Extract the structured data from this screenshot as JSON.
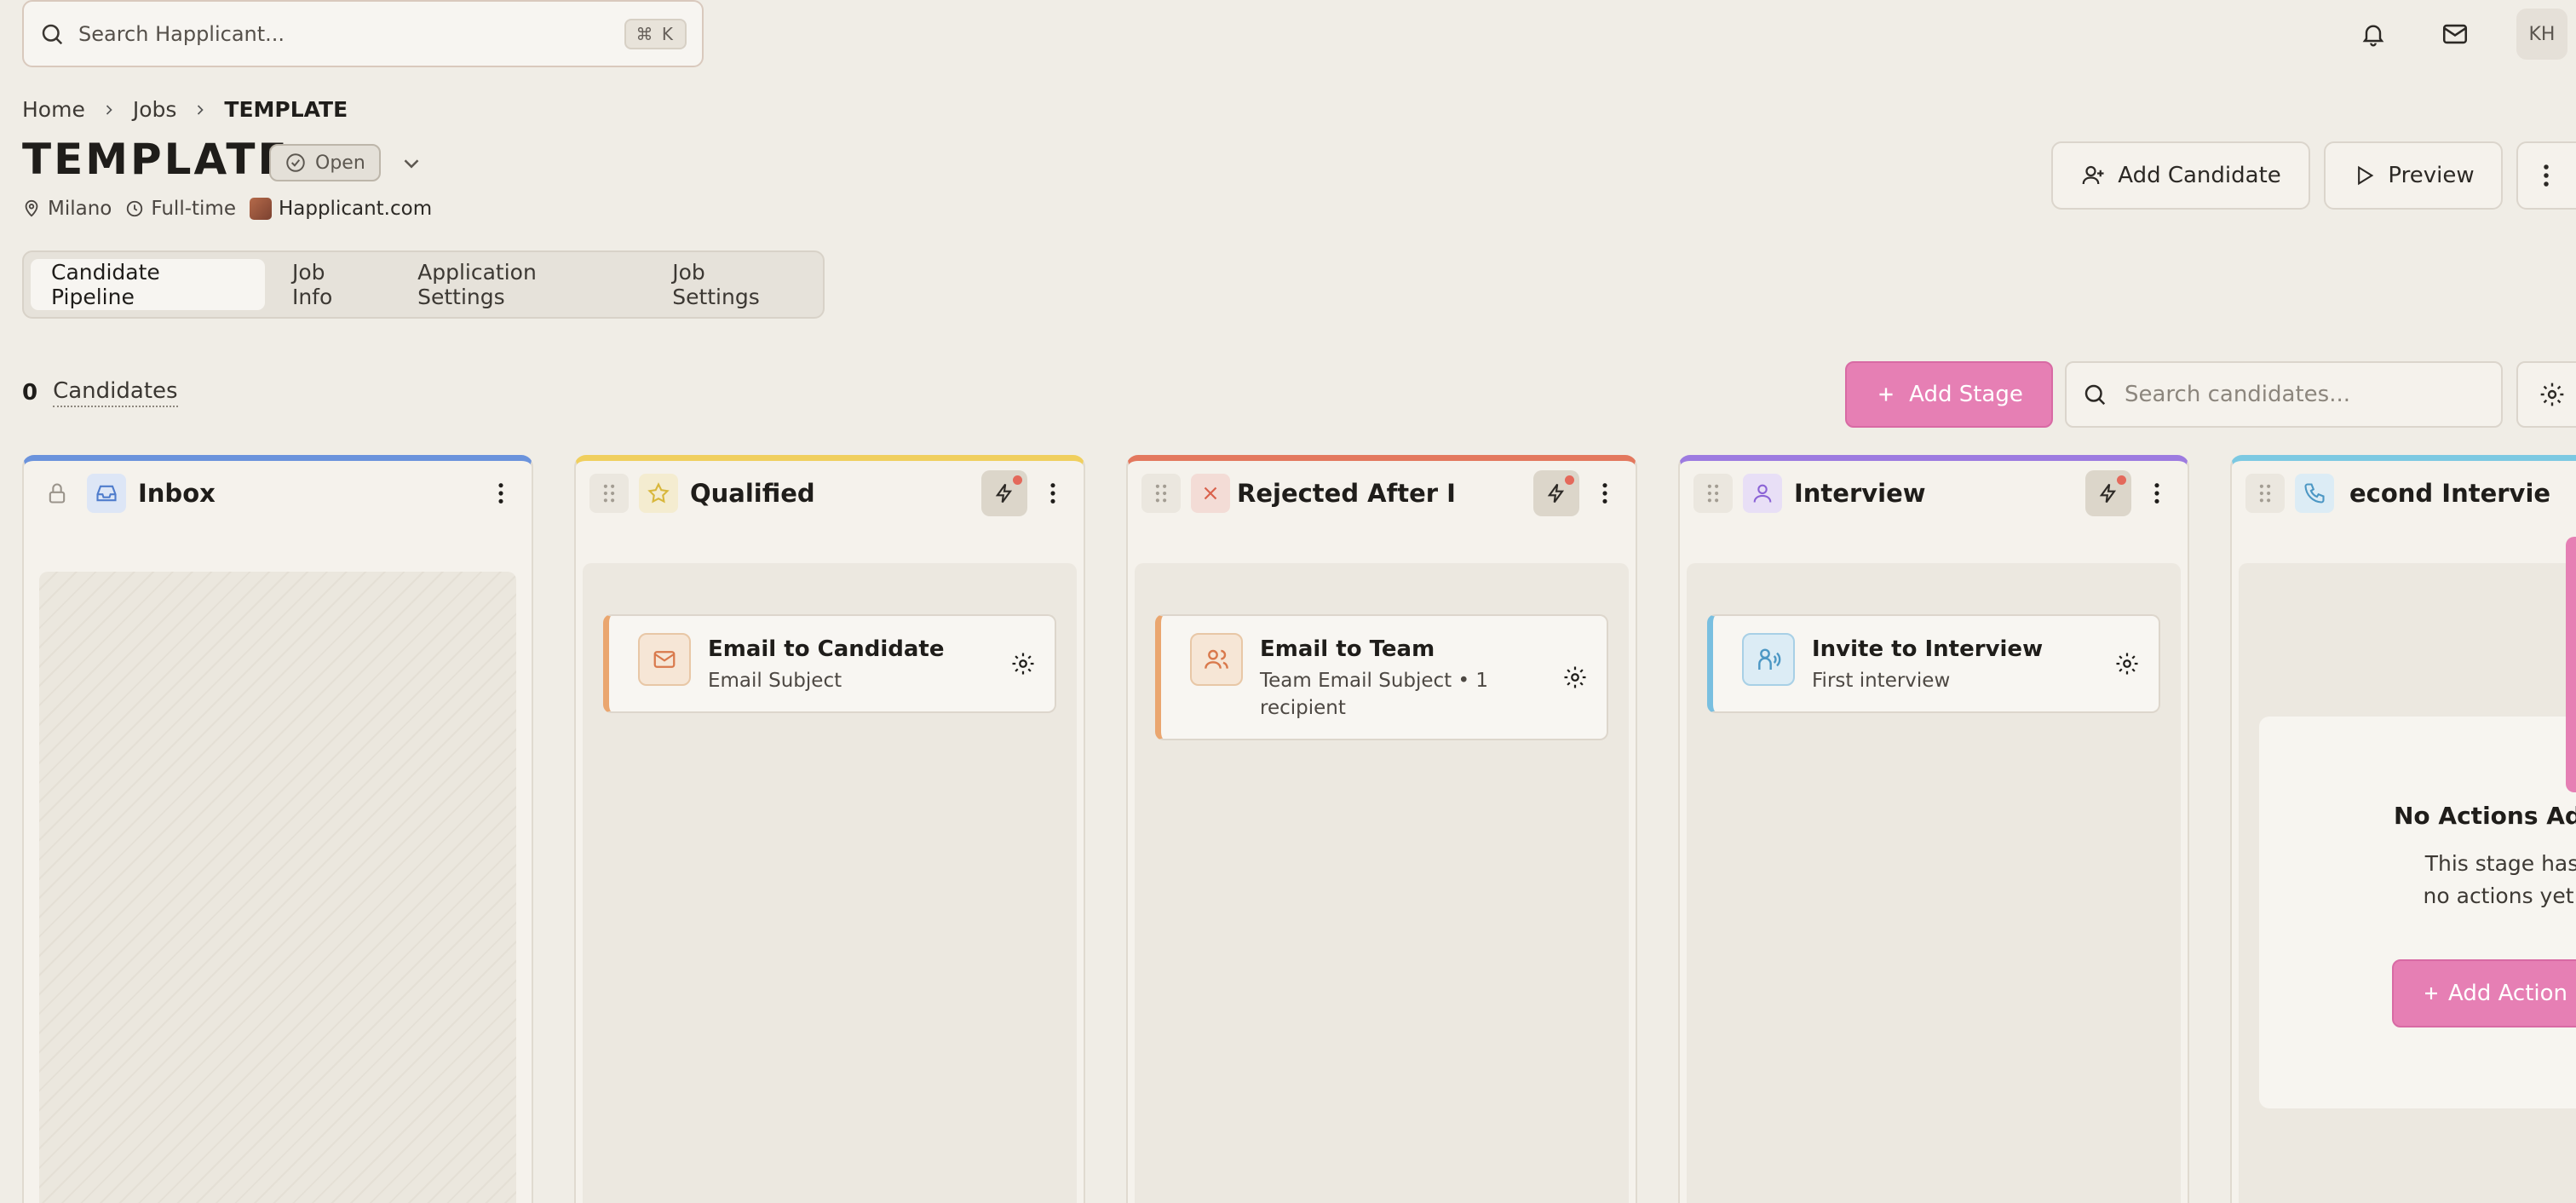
{
  "search": {
    "placeholder": "Search Happlicant...",
    "shortcut": "⌘ K"
  },
  "topbar": {
    "avatar_initials": "KH"
  },
  "breadcrumb": [
    "Home",
    "Jobs",
    "TEMPLATE"
  ],
  "job": {
    "title": "TEMPLATE",
    "status": "Open",
    "location": "Milano",
    "employment_type": "Full-time",
    "company": "Happlicant.com"
  },
  "header_actions": {
    "add_candidate": "Add Candidate",
    "preview": "Preview"
  },
  "tabs": [
    "Candidate Pipeline",
    "Job Info",
    "Application Settings",
    "Job Settings"
  ],
  "toolbar": {
    "candidate_count": "0",
    "candidates_label": "Candidates",
    "add_stage": "Add Stage",
    "search_placeholder": "Search candidates..."
  },
  "stages": [
    {
      "title": "Inbox",
      "color": "#6b93dc"
    },
    {
      "title": "Qualified",
      "color": "#f0cf5e",
      "action": {
        "title": "Email to Candidate",
        "subtitle": "Email Subject"
      }
    },
    {
      "title": "Rejected After I",
      "color": "#e3785e",
      "action": {
        "title": "Email to Team",
        "subtitle": "Team Email Subject • 1 recipient"
      }
    },
    {
      "title": "Interview",
      "color": "#9d7be0",
      "action": {
        "title": "Invite to Interview",
        "subtitle": "First interview"
      }
    },
    {
      "title": "econd Intervie",
      "color": "#7cc9e2",
      "empty": {
        "title": "No Actions Adde",
        "text": "This stage has no actions yet.",
        "button": "Add Action"
      }
    }
  ]
}
